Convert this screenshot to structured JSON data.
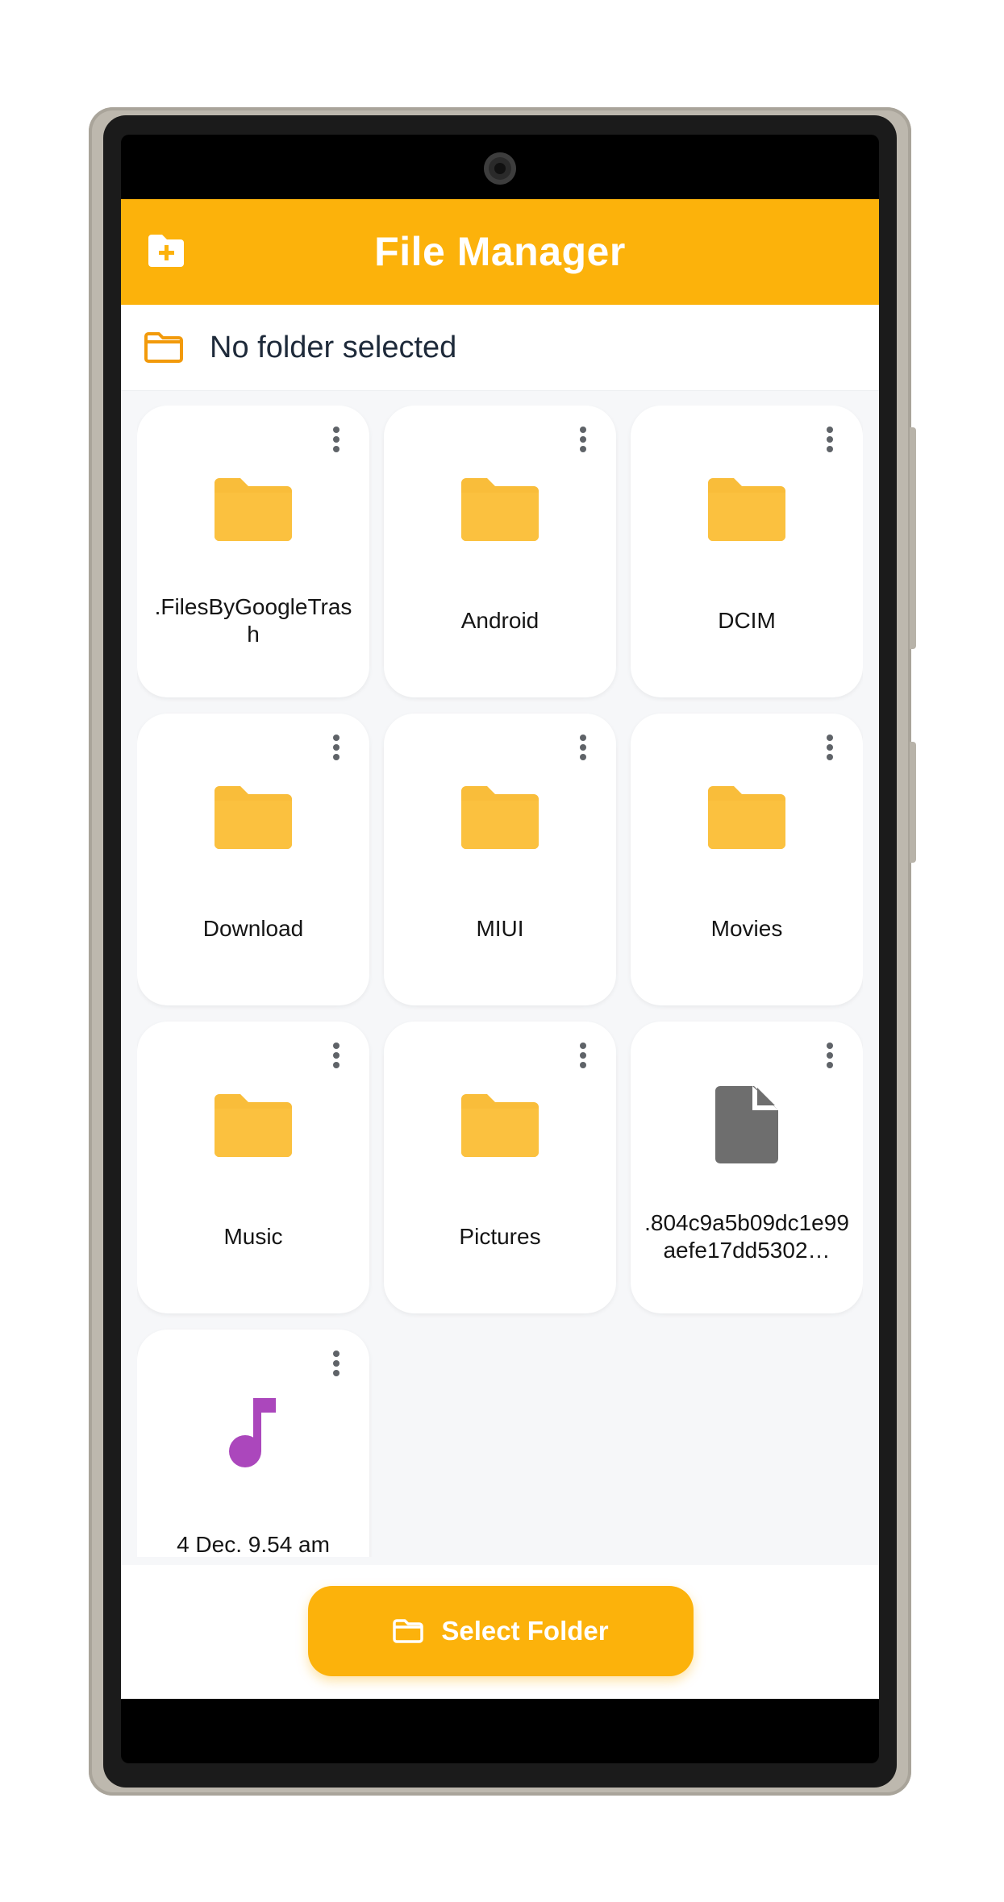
{
  "app": {
    "title": "File Manager",
    "accent_color": "#fcb20b",
    "header_icon": "create-folder-icon"
  },
  "path_bar": {
    "icon": "folder-outline-icon",
    "text": "No folder selected"
  },
  "items": [
    {
      "name": ".FilesByGoogleTrash",
      "type": "folder"
    },
    {
      "name": "Android",
      "type": "folder"
    },
    {
      "name": "DCIM",
      "type": "folder"
    },
    {
      "name": "Download",
      "type": "folder"
    },
    {
      "name": "MIUI",
      "type": "folder"
    },
    {
      "name": "Movies",
      "type": "folder"
    },
    {
      "name": "Music",
      "type": "folder"
    },
    {
      "name": "Pictures",
      "type": "folder"
    },
    {
      "name": ".804c9a5b09dc1e99aefe17dd5302…",
      "type": "file"
    },
    {
      "name": "4 Dec. 9.54 am",
      "type": "audio"
    }
  ],
  "item_menu_icon": "more-vertical-icon",
  "bottom": {
    "select_button_label": "Select Folder",
    "select_button_icon": "folder-outline-icon"
  }
}
